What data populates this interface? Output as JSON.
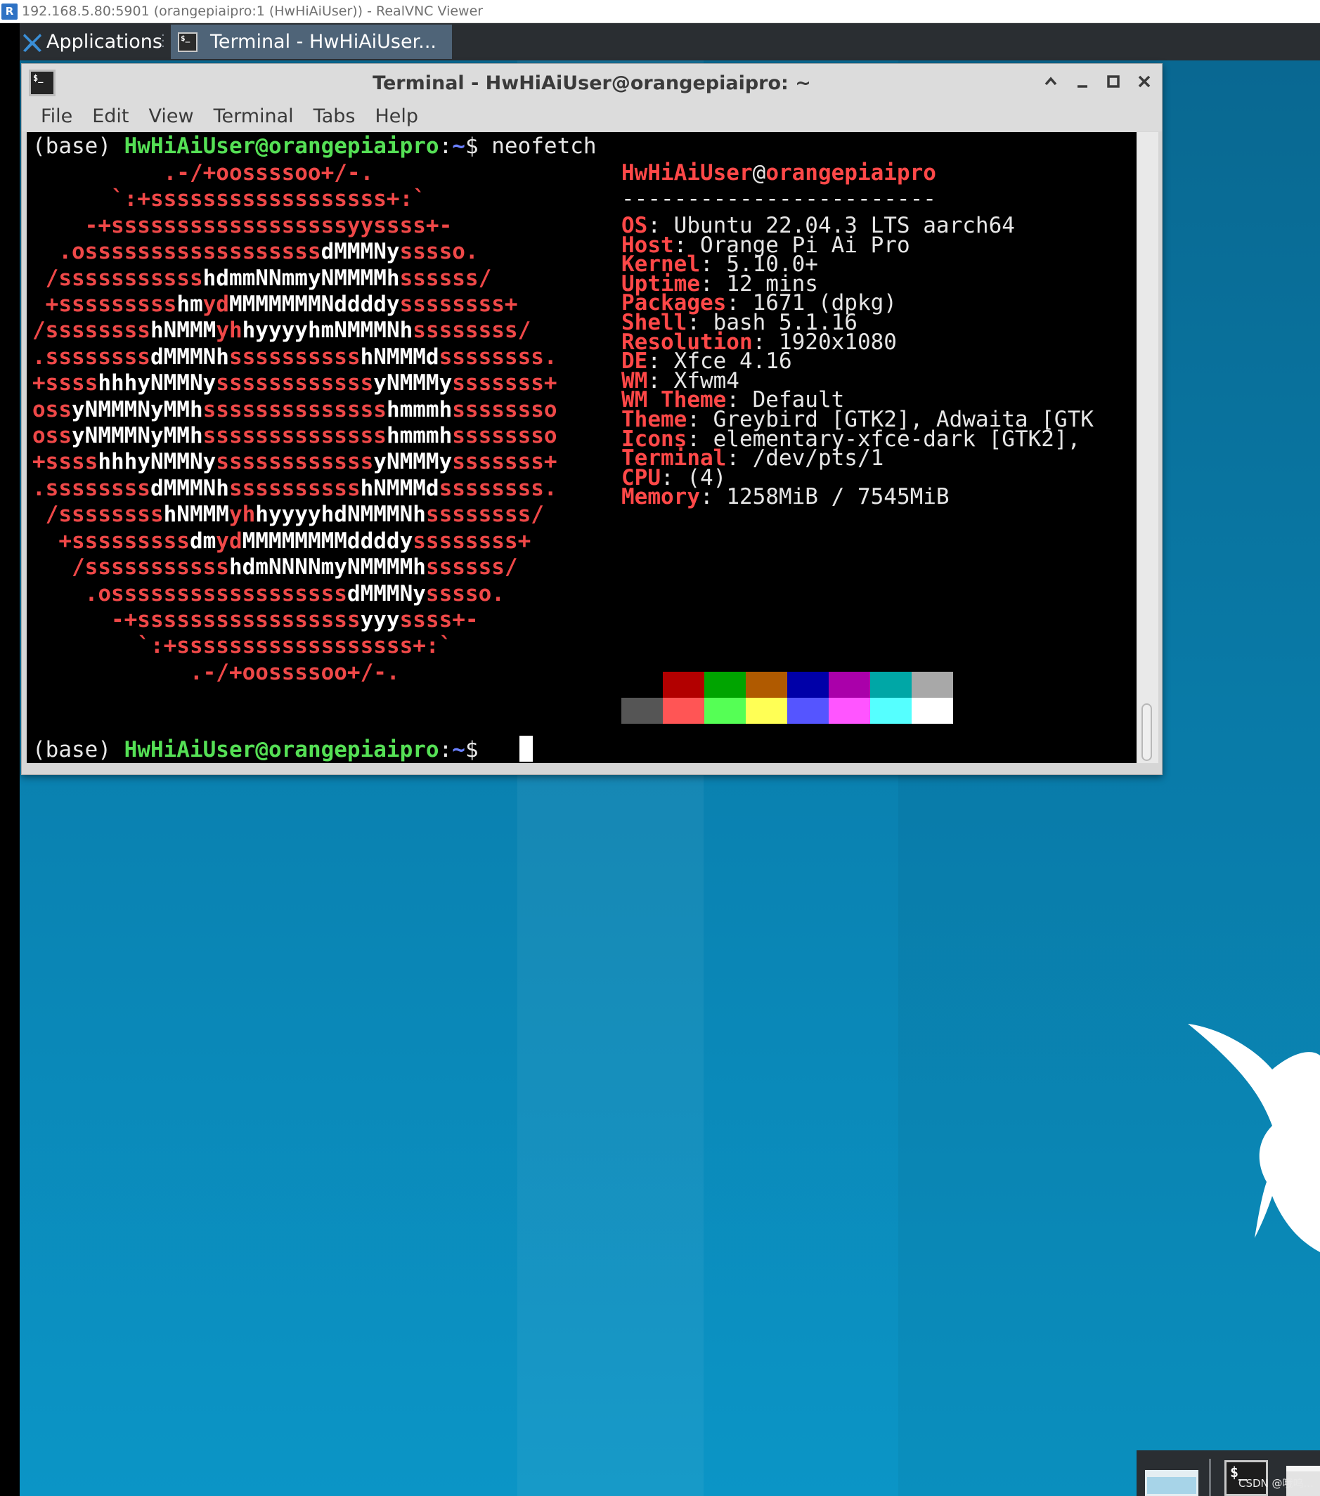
{
  "vnc": {
    "title": "192.168.5.80:5901 (orangepiaipro:1 (HwHiAiUser)) - RealVNC Viewer",
    "logo_text": "R"
  },
  "panel": {
    "applications_label": "Applications",
    "task_label": "Terminal - HwHiAiUser..."
  },
  "window": {
    "title": "Terminal - HwHiAiUser@orangepiaipro: ~",
    "menu": [
      "File",
      "Edit",
      "View",
      "Terminal",
      "Tabs",
      "Help"
    ]
  },
  "terminal": {
    "prompt_env": "(base) ",
    "prompt_user_host": "HwHiAiUser@orangepiaipro",
    "prompt_colon": ":",
    "prompt_path": "~",
    "prompt_dollar": "$ ",
    "command": "neofetch",
    "ascii_logo": [
      [
        "          .-/+oossssoo+/-."
      ],
      [
        "      `:+ssssssssssssssssss+:`"
      ],
      [
        "    -+ssssssssssssssssssyyssss+-"
      ],
      [
        "  .ossssssssssssssssss",
        "dMMMNy",
        "sssso."
      ],
      [
        " /sssssssssss",
        "hdmmNNmmyNMMMMh",
        "ssssss/"
      ],
      [
        " +sssssssss",
        "hm",
        "yd",
        "MMMMMMMNddddy",
        "ssssssss+"
      ],
      [
        "/ssssssss",
        "hNMMM",
        "yh",
        "hyyyyhmNMMMNh",
        "ssssssss/"
      ],
      [
        ".ssssssss",
        "dMMMNh",
        "ssssssssss",
        "hNMMMd",
        "ssssssss."
      ],
      [
        "+ssss",
        "hhhyNMMNy",
        "ssssssssssss",
        "yNMMMy",
        "sssssss+"
      ],
      [
        "oss",
        "yNMMMNyMMh",
        "ssssssssssssss",
        "hmmmh",
        "ssssssso"
      ],
      [
        "oss",
        "yNMMMNyMMh",
        "ssssssssssssss",
        "hmmmh",
        "ssssssso"
      ],
      [
        "+ssss",
        "hhhyNMMNy",
        "ssssssssssss",
        "yNMMMy",
        "sssssss+"
      ],
      [
        ".ssssssss",
        "dMMMNh",
        "ssssssssss",
        "hNMMMd",
        "ssssssss."
      ],
      [
        " /ssssssss",
        "hNMMM",
        "yh",
        "hyyyyhdNMMMNh",
        "ssssssss/"
      ],
      [
        "  +sssssssss",
        "dm",
        "yd",
        "MMMMMMMMddddy",
        "ssssssss+"
      ],
      [
        "   /sssssssssss",
        "hdmNNNNmyNMMMMh",
        "ssssss/"
      ],
      [
        "    .ossssssssssssssssss",
        "dMMMNy",
        "sssso."
      ],
      [
        "      -+sssssssssssssssss",
        "yyy",
        "ssss+-"
      ],
      [
        "        `:+ssssssssssssssssss+:`"
      ],
      [
        "            .-/+oossssoo+/-."
      ]
    ],
    "info_header": {
      "user": "HwHiAiUser",
      "at": "@",
      "host": "orangepiaipro",
      "rule": "------------------------"
    },
    "info": [
      {
        "key": "OS",
        "value": "Ubuntu 22.04.3 LTS aarch64"
      },
      {
        "key": "Host",
        "value": "Orange Pi Ai Pro"
      },
      {
        "key": "Kernel",
        "value": "5.10.0+"
      },
      {
        "key": "Uptime",
        "value": "12 mins"
      },
      {
        "key": "Packages",
        "value": "1671 (dpkg)"
      },
      {
        "key": "Shell",
        "value": "bash 5.1.16"
      },
      {
        "key": "Resolution",
        "value": "1920x1080"
      },
      {
        "key": "DE",
        "value": "Xfce 4.16"
      },
      {
        "key": "WM",
        "value": "Xfwm4"
      },
      {
        "key": "WM Theme",
        "value": "Default"
      },
      {
        "key": "Theme",
        "value": "Greybird [GTK2], Adwaita [GTK"
      },
      {
        "key": "Icons",
        "value": "elementary-xfce-dark [GTK2],"
      },
      {
        "key": "Terminal",
        "value": "/dev/pts/1"
      },
      {
        "key": "CPU",
        "value": "(4)"
      },
      {
        "key": "Memory",
        "value": "1258MiB / 7545MiB"
      }
    ],
    "palette_row1": [
      "#000000",
      "#b20000",
      "#00a400",
      "#b05a00",
      "#0000a8",
      "#aa00aa",
      "#00a7a6",
      "#a8a8a8"
    ],
    "palette_row2": [
      "#555555",
      "#ff5555",
      "#55ff55",
      "#ffff55",
      "#5555ff",
      "#ff55ff",
      "#55ffff",
      "#ffffff"
    ]
  },
  "taskbar_bottom": {
    "terminal_icon_text": "$_"
  },
  "watermark": "CSDN @哦呜..."
}
